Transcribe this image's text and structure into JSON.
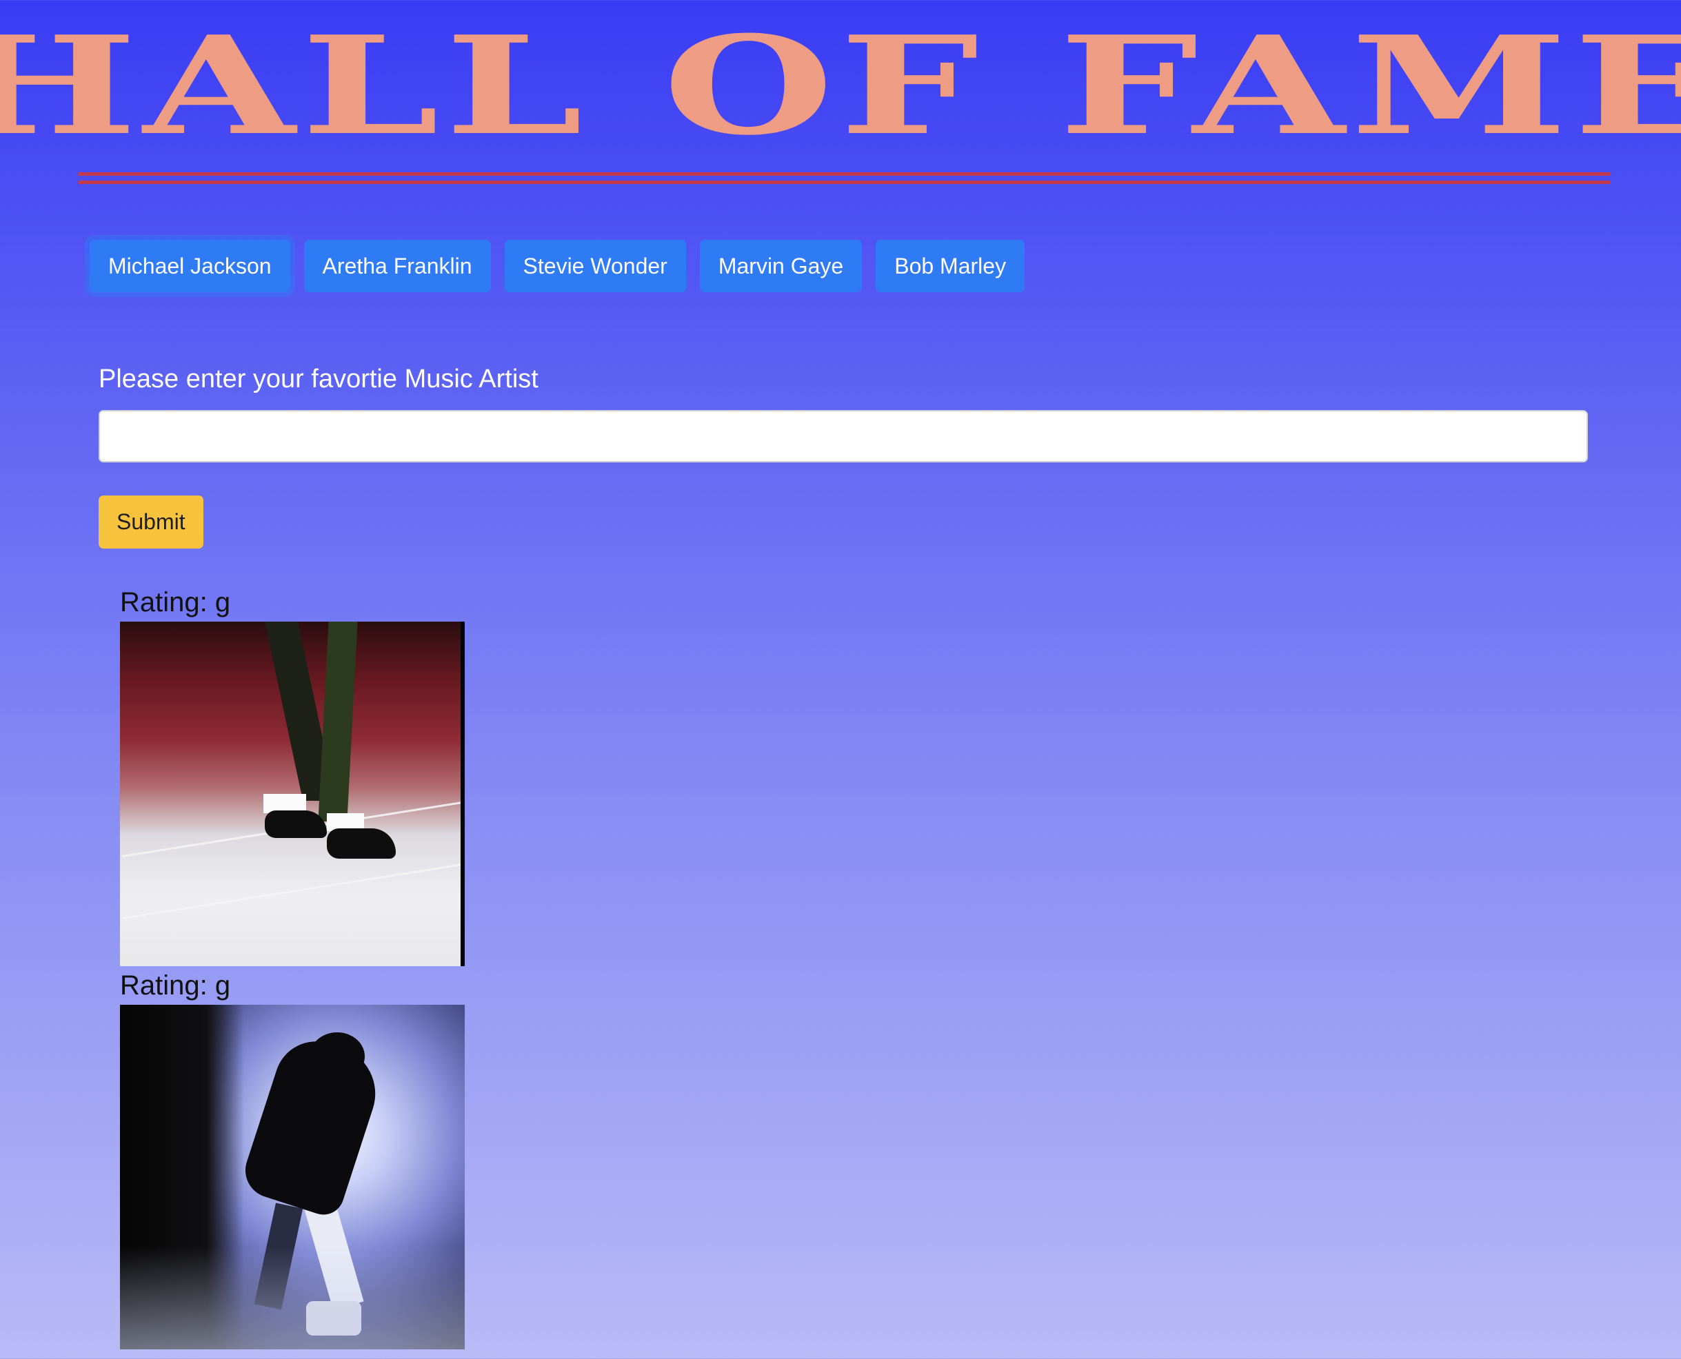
{
  "header": {
    "title": "HALL OF FAME"
  },
  "artist_buttons": [
    {
      "label": "Michael Jackson",
      "focused": true
    },
    {
      "label": "Aretha Franklin",
      "focused": false
    },
    {
      "label": "Stevie Wonder",
      "focused": false
    },
    {
      "label": "Marvin Gaye",
      "focused": false
    },
    {
      "label": "Bob Marley",
      "focused": false
    }
  ],
  "form": {
    "label": "Please enter your favortie Music Artist",
    "input_value": "",
    "submit_label": "Submit"
  },
  "results": [
    {
      "rating": "Rating: g",
      "image": "dancing-feet-gif"
    },
    {
      "rating": "Rating: g",
      "image": "silhouette-dance-gif"
    }
  ],
  "colors": {
    "background_top": "#3a3cf4",
    "background_bottom": "#b9baf6",
    "title": "#ee9c84",
    "divider": "#c43a4a",
    "artist_button": "#2f7bf5",
    "submit_button": "#f7c23c"
  }
}
